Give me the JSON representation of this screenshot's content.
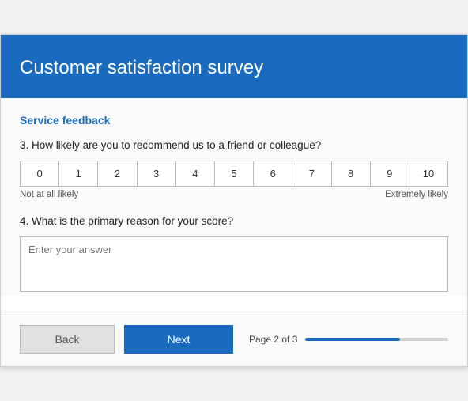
{
  "header": {
    "title": "Customer satisfaction survey"
  },
  "section": {
    "title": "Service feedback"
  },
  "questions": [
    {
      "number": "3.",
      "text": "How likely are you to recommend us to a friend or colleague?",
      "type": "nps",
      "options": [
        "0",
        "1",
        "2",
        "3",
        "4",
        "5",
        "6",
        "7",
        "8",
        "9",
        "10"
      ],
      "label_left": "Not at all likely",
      "label_right": "Extremely likely"
    },
    {
      "number": "4.",
      "text": "What is the primary reason for your score?",
      "type": "textarea",
      "placeholder": "Enter your answer"
    }
  ],
  "footer": {
    "back_label": "Back",
    "next_label": "Next",
    "page_indicator": "Page 2 of 3",
    "progress_percent": 66
  }
}
